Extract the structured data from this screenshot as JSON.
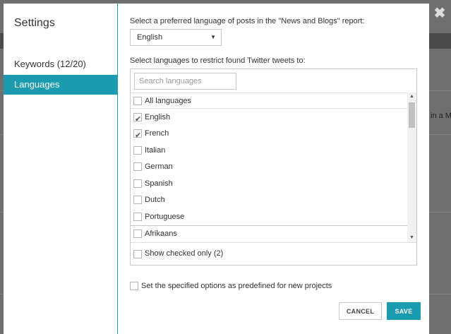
{
  "background": {
    "right_text": "in a Mai"
  },
  "dialog": {
    "title": "Settings",
    "close_symbol": "✖",
    "sidebar_items": [
      {
        "label": "Keywords (12/20)",
        "active": false
      },
      {
        "label": "Languages",
        "active": true
      }
    ],
    "posts_language_label": "Select a preferred language of posts in the \"News and Blogs\" report:",
    "posts_language_value": "English",
    "twitter_label": "Select languages to restrict found Twitter tweets to:",
    "search_placeholder": "Search languages",
    "languages": [
      {
        "label": "All languages",
        "checked": false
      },
      {
        "label": "English",
        "checked": true
      },
      {
        "label": "French",
        "checked": true
      },
      {
        "label": "Italian",
        "checked": false
      },
      {
        "label": "German",
        "checked": false
      },
      {
        "label": "Spanish",
        "checked": false
      },
      {
        "label": "Dutch",
        "checked": false
      },
      {
        "label": "Portuguese",
        "checked": false
      },
      {
        "label": "Afrikaans",
        "checked": false
      }
    ],
    "show_checked_label": "Show checked only (2)",
    "predefined_label": "Set the specified options as predefined for new projects",
    "cancel_label": "CANCEL",
    "save_label": "SAVE"
  },
  "colors": {
    "accent": "#1a9bb0"
  }
}
